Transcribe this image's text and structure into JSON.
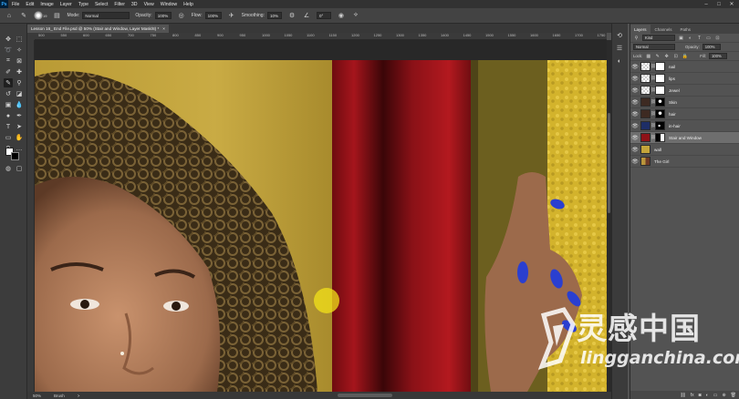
{
  "app": {
    "logo": "Ps"
  },
  "menu": [
    "File",
    "Edit",
    "Image",
    "Layer",
    "Type",
    "Select",
    "Filter",
    "3D",
    "View",
    "Window",
    "Help"
  ],
  "window_controls": {
    "minimize": "–",
    "maximize": "□",
    "close": "✕"
  },
  "options_bar": {
    "brush_size": "19",
    "mode_label": "Mode:",
    "mode_value": "Normal",
    "opacity_label": "Opacity:",
    "opacity_value": "100%",
    "flow_label": "Flow:",
    "flow_value": "100%",
    "smoothing_label": "Smoothing:",
    "smoothing_value": "10%",
    "angle_value": "0°"
  },
  "document_tab": {
    "title": "Lesson 16_ End File.psd @ 50% (Stair and Window, Layer Mask/8) *",
    "close": "×"
  },
  "ruler_ticks": [
    "500",
    "550",
    "600",
    "650",
    "700",
    "750",
    "800",
    "850",
    "900",
    "950",
    "1000",
    "1050",
    "1100",
    "1150",
    "1200",
    "1250",
    "1300",
    "1350",
    "1400",
    "1450",
    "1500",
    "1550",
    "1600",
    "1650",
    "1700",
    "1750"
  ],
  "status_bar": {
    "zoom": "50%",
    "info": "Brush",
    "arrow": ">"
  },
  "layers_panel": {
    "tabs": [
      "Layers",
      "Channels",
      "Paths"
    ],
    "filter_kind": "Kind",
    "blend_mode": "Normal",
    "opacity_label": "Opacity:",
    "opacity_value": "100%",
    "lock_label": "Lock:",
    "fill_label": "Fill:",
    "fill_value": "100%",
    "layers": [
      {
        "name": "nail",
        "thumb": "checker",
        "mask": "white",
        "selected": false
      },
      {
        "name": "lips",
        "thumb": "checker",
        "mask": "white",
        "selected": false
      },
      {
        "name": "Jewel",
        "thumb": "checker",
        "mask": "white",
        "selected": false
      },
      {
        "name": "Skin",
        "thumb": "adjust",
        "mask": "dark",
        "selected": false
      },
      {
        "name": "hair",
        "thumb": "adjust",
        "mask": "dark",
        "selected": false
      },
      {
        "name": "in-hair",
        "thumb": "adjust-blue",
        "mask": "black",
        "selected": false
      },
      {
        "name": "Stair and Window",
        "thumb": "red",
        "mask": "split",
        "selected": true
      },
      {
        "name": "wall",
        "thumb": "yellow",
        "mask": "none",
        "selected": false
      },
      {
        "name": "The Girl",
        "thumb": "photo",
        "mask": "none",
        "selected": false
      }
    ]
  },
  "watermark": {
    "cn": "灵感中国",
    "en": "lingganchina.com"
  },
  "colors": {
    "wall": "#c4a43a",
    "curtain": "#8e1218",
    "nail_polish": "#2a3fd0",
    "accent_selected_layer": "#6e6e6e"
  }
}
